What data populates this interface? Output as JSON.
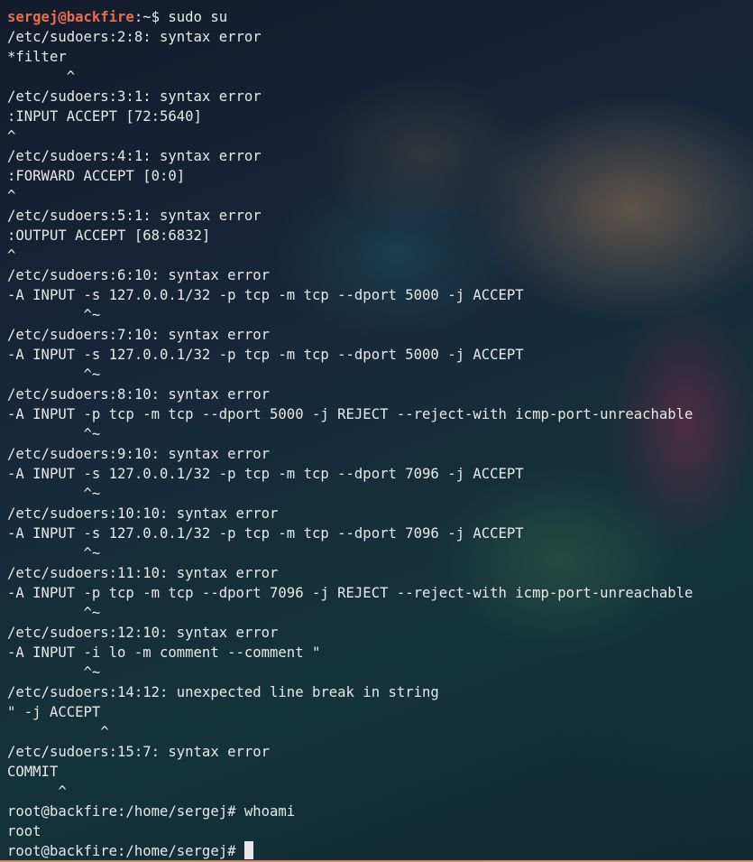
{
  "prompt1": {
    "user_host": "sergej@backfire",
    "path_sep": ":~$ ",
    "command": "sudo su"
  },
  "output": [
    "/etc/sudoers:2:8: syntax error",
    "*filter",
    "       ^",
    "/etc/sudoers:3:1: syntax error",
    ":INPUT ACCEPT [72:5640]",
    "^",
    "/etc/sudoers:4:1: syntax error",
    ":FORWARD ACCEPT [0:0]",
    "^",
    "/etc/sudoers:5:1: syntax error",
    ":OUTPUT ACCEPT [68:6832]",
    "^",
    "/etc/sudoers:6:10: syntax error",
    "-A INPUT -s 127.0.0.1/32 -p tcp -m tcp --dport 5000 -j ACCEPT",
    "         ^~",
    "/etc/sudoers:7:10: syntax error",
    "-A INPUT -s 127.0.0.1/32 -p tcp -m tcp --dport 5000 -j ACCEPT",
    "         ^~",
    "/etc/sudoers:8:10: syntax error",
    "-A INPUT -p tcp -m tcp --dport 5000 -j REJECT --reject-with icmp-port-unreachable",
    "         ^~",
    "/etc/sudoers:9:10: syntax error",
    "-A INPUT -s 127.0.0.1/32 -p tcp -m tcp --dport 7096 -j ACCEPT",
    "         ^~",
    "/etc/sudoers:10:10: syntax error",
    "-A INPUT -s 127.0.0.1/32 -p tcp -m tcp --dport 7096 -j ACCEPT",
    "         ^~",
    "/etc/sudoers:11:10: syntax error",
    "-A INPUT -p tcp -m tcp --dport 7096 -j REJECT --reject-with icmp-port-unreachable",
    "         ^~",
    "/etc/sudoers:12:10: syntax error",
    "-A INPUT -i lo -m comment --comment \"",
    "         ^~",
    "/etc/sudoers:14:12: unexpected line break in string",
    "\" -j ACCEPT",
    "           ^",
    "/etc/sudoers:15:7: syntax error",
    "COMMIT",
    "      ^",
    "root@backfire:/home/sergej# whoami",
    "root"
  ],
  "prompt_final": "root@backfire:/home/sergej# ",
  "colors": {
    "user_host": "#e96f4c",
    "text": "#e8e8e8"
  }
}
